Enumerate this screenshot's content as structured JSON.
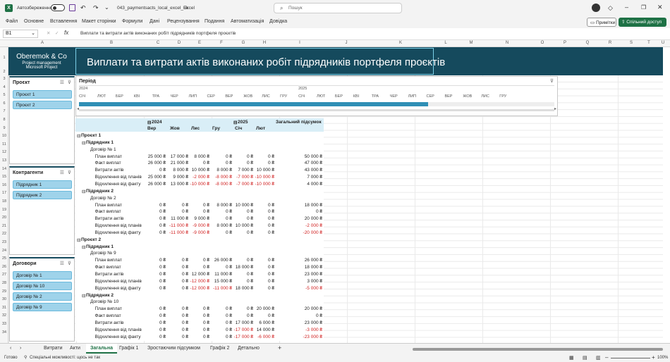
{
  "titlebar": {
    "autosave": "Автозбереження",
    "filename": "043_paymentsacts_local_excel_uk",
    "app": "Excel",
    "search": "Пошук"
  },
  "menu": [
    "Файл",
    "Основне",
    "Вставлення",
    "Макет сторінки",
    "Формули",
    "Дані",
    "Рецензування",
    "Подання",
    "Автоматизація",
    "Довідка"
  ],
  "comments_btn": "Примітки",
  "share_btn": "Спільний доступ",
  "namebox": "B1",
  "formula": "Виплати та витрати актів виконаних робіт підрядників портфеля проєктів",
  "columns": [
    "A",
    "B",
    "C",
    "D",
    "E",
    "F",
    "G",
    "H",
    "I",
    "J",
    "K",
    "L",
    "M",
    "N",
    "O",
    "P",
    "Q",
    "R",
    "S",
    "T",
    "U"
  ],
  "rows": [
    "1",
    "2",
    "3",
    "4",
    "5",
    "6",
    "7",
    "8",
    "9",
    "10",
    "11",
    "12",
    "13",
    "14",
    "15",
    "16",
    "17",
    "18",
    "19",
    "20",
    "21",
    "22",
    "23",
    "24",
    "25",
    "26",
    "27",
    "28",
    "29",
    "30",
    "31",
    "32",
    "33",
    "34"
  ],
  "logo": {
    "name": "Oberemok & Co",
    "line1": "Project management",
    "line2": "Microsoft Project"
  },
  "title": "Виплати та витрати актів виконаних робіт підрядників портфеля проєктів",
  "slicers": [
    {
      "title": "Проєкт",
      "items": [
        "Проєкт 1",
        "Проєкт 2"
      ]
    },
    {
      "title": "Контрагенти",
      "items": [
        "Підрядник 1",
        "Підрядник 2"
      ]
    },
    {
      "title": "Договори",
      "items": [
        "Договір № 1",
        "Договір № 10",
        "Договір № 2",
        "Договір № 9"
      ]
    }
  ],
  "timeline": {
    "title": "Період",
    "years": [
      "2024",
      "2025"
    ],
    "months": [
      "СІЧ",
      "ЛЮТ",
      "БЕР",
      "КВІ",
      "ТРА",
      "ЧЕР",
      "ЛИП",
      "СЕР",
      "ВЕР",
      "ЖОВ",
      "ЛИС",
      "ГРУ",
      "СІЧ",
      "ЛЮТ",
      "БЕР",
      "КВІ",
      "ТРА",
      "ЧЕР",
      "ЛИП",
      "СЕР",
      "ВЕР",
      "ЖОВ",
      "ЛИС",
      "ГРУ"
    ],
    "selected_fraction": 0.34
  },
  "pivot": {
    "header": {
      "y2024": "2024",
      "y2025": "2025",
      "total": "Загальний підсумок",
      "months": [
        "Вер",
        "Жов",
        "Лис",
        "Гру",
        "Січ",
        "Лют"
      ]
    },
    "rows": [
      {
        "label": "Проєкт 1",
        "level": 0,
        "bold": true
      },
      {
        "label": "Підрядник 1",
        "level": 1,
        "bold": true
      },
      {
        "label": "Договір № 1",
        "level": 2
      },
      {
        "label": "План виплат",
        "level": 3,
        "values": [
          "25 000 ₴",
          "17 000 ₴",
          "8 000 ₴",
          "0 ₴",
          "0 ₴",
          "0 ₴",
          "50 000 ₴"
        ]
      },
      {
        "label": "Факт виплат",
        "level": 3,
        "values": [
          "26 000 ₴",
          "21 000 ₴",
          "0 ₴",
          "0 ₴",
          "0 ₴",
          "0 ₴",
          "47 000 ₴"
        ]
      },
      {
        "label": "Витрати актів",
        "level": 3,
        "values": [
          "0 ₴",
          "8 000 ₴",
          "10 000 ₴",
          "8 000 ₴",
          "7 000 ₴",
          "10 000 ₴",
          "43 000 ₴"
        ]
      },
      {
        "label": "Відхилення від планів",
        "level": 3,
        "values": [
          "25 000 ₴",
          "9 000 ₴",
          "-2 000 ₴",
          "-8 000 ₴",
          "-7 000 ₴",
          "-10 000 ₴",
          "7 000 ₴"
        ]
      },
      {
        "label": "Відхилення від факту",
        "level": 3,
        "values": [
          "26 000 ₴",
          "13 000 ₴",
          "-10 000 ₴",
          "-8 000 ₴",
          "-7 000 ₴",
          "-10 000 ₴",
          "4 000 ₴"
        ]
      },
      {
        "label": "Підрядник 2",
        "level": 1,
        "bold": true
      },
      {
        "label": "Договір № 2",
        "level": 2
      },
      {
        "label": "План виплат",
        "level": 3,
        "values": [
          "0 ₴",
          "0 ₴",
          "0 ₴",
          "8 000 ₴",
          "10 000 ₴",
          "0 ₴",
          "18 000 ₴"
        ]
      },
      {
        "label": "Факт виплат",
        "level": 3,
        "values": [
          "0 ₴",
          "0 ₴",
          "0 ₴",
          "0 ₴",
          "0 ₴",
          "0 ₴",
          "0 ₴"
        ]
      },
      {
        "label": "Витрати актів",
        "level": 3,
        "values": [
          "0 ₴",
          "11 000 ₴",
          "9 000 ₴",
          "0 ₴",
          "0 ₴",
          "0 ₴",
          "20 000 ₴"
        ]
      },
      {
        "label": "Відхилення від планів",
        "level": 3,
        "values": [
          "0 ₴",
          "-11 000 ₴",
          "-9 000 ₴",
          "8 000 ₴",
          "10 000 ₴",
          "0 ₴",
          "-2 000 ₴"
        ]
      },
      {
        "label": "Відхилення від факту",
        "level": 3,
        "values": [
          "0 ₴",
          "-11 000 ₴",
          "-9 000 ₴",
          "0 ₴",
          "0 ₴",
          "0 ₴",
          "-20 000 ₴"
        ]
      },
      {
        "label": "Проєкт 2",
        "level": 0,
        "bold": true
      },
      {
        "label": "Підрядник 1",
        "level": 1,
        "bold": true
      },
      {
        "label": "Договір № 9",
        "level": 2
      },
      {
        "label": "План виплат",
        "level": 3,
        "values": [
          "0 ₴",
          "0 ₴",
          "0 ₴",
          "26 000 ₴",
          "0 ₴",
          "0 ₴",
          "26 000 ₴"
        ]
      },
      {
        "label": "Факт виплат",
        "level": 3,
        "values": [
          "0 ₴",
          "0 ₴",
          "0 ₴",
          "0 ₴",
          "18 000 ₴",
          "0 ₴",
          "18 000 ₴"
        ]
      },
      {
        "label": "Витрати актів",
        "level": 3,
        "values": [
          "0 ₴",
          "0 ₴",
          "12 000 ₴",
          "11 000 ₴",
          "0 ₴",
          "0 ₴",
          "23 000 ₴"
        ]
      },
      {
        "label": "Відхилення від планів",
        "level": 3,
        "values": [
          "0 ₴",
          "0 ₴",
          "-12 000 ₴",
          "15 000 ₴",
          "0 ₴",
          "0 ₴",
          "3 000 ₴"
        ]
      },
      {
        "label": "Відхилення від факту",
        "level": 3,
        "values": [
          "0 ₴",
          "0 ₴",
          "-12 000 ₴",
          "-11 000 ₴",
          "18 000 ₴",
          "0 ₴",
          "-5 000 ₴"
        ]
      },
      {
        "label": "Підрядник 2",
        "level": 1,
        "bold": true
      },
      {
        "label": "Договір № 10",
        "level": 2
      },
      {
        "label": "План виплат",
        "level": 3,
        "values": [
          "0 ₴",
          "0 ₴",
          "0 ₴",
          "0 ₴",
          "0 ₴",
          "20 000 ₴",
          "20 000 ₴"
        ]
      },
      {
        "label": "Факт виплат",
        "level": 3,
        "values": [
          "0 ₴",
          "0 ₴",
          "0 ₴",
          "0 ₴",
          "0 ₴",
          "0 ₴",
          "0 ₴"
        ]
      },
      {
        "label": "Витрати актів",
        "level": 3,
        "values": [
          "0 ₴",
          "0 ₴",
          "0 ₴",
          "0 ₴",
          "17 000 ₴",
          "6 000 ₴",
          "23 000 ₴"
        ]
      },
      {
        "label": "Відхилення від планів",
        "level": 3,
        "values": [
          "0 ₴",
          "0 ₴",
          "0 ₴",
          "0 ₴",
          "-17 000 ₴",
          "14 000 ₴",
          "-3 000 ₴"
        ]
      },
      {
        "label": "Відхилення від факту",
        "level": 3,
        "values": [
          "0 ₴",
          "0 ₴",
          "0 ₴",
          "0 ₴",
          "-17 000 ₴",
          "-6 000 ₴",
          "-23 000 ₴"
        ]
      }
    ]
  },
  "tabs": [
    "Витрати",
    "Акти",
    "Загальна",
    "Графік 1",
    "Зростаючим підсумком",
    "Графік 2",
    "Детально"
  ],
  "active_tab": "Загальна",
  "status": {
    "ready": "Готово",
    "accessibility": "Спеціальні можливості: щось не так",
    "zoom": "100%"
  }
}
